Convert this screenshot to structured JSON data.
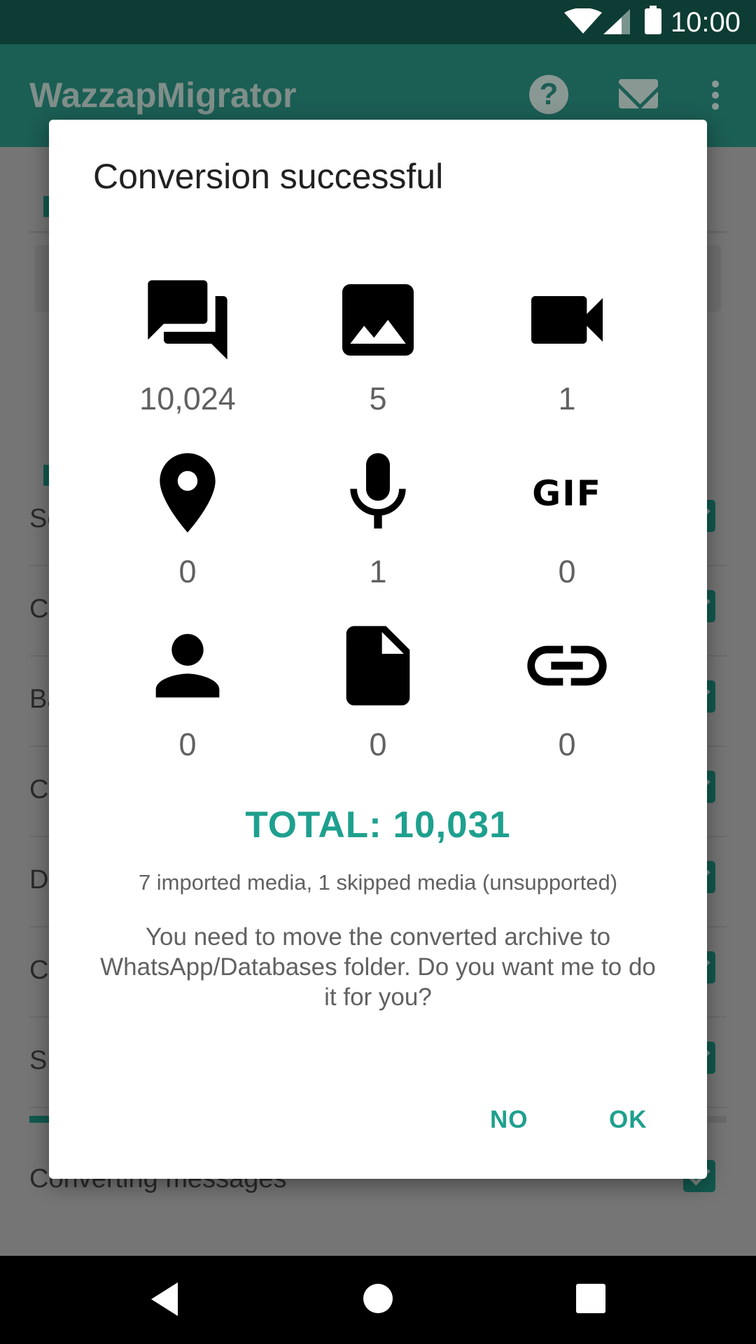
{
  "status_bar": {
    "time": "10:00"
  },
  "app_bar": {
    "title": "WazzapMigrator"
  },
  "background": {
    "rows": [
      {
        "label": "Se"
      },
      {
        "label": "Cr"
      },
      {
        "label": "Ba"
      },
      {
        "label": "Co"
      },
      {
        "label": "De"
      },
      {
        "label": "Cr"
      },
      {
        "label": "Sp"
      },
      {
        "label": "Converting messages"
      }
    ]
  },
  "dialog": {
    "title": "Conversion successful",
    "stats": [
      {
        "icon": "chat-icon",
        "value": "10,024"
      },
      {
        "icon": "image-icon",
        "value": "5"
      },
      {
        "icon": "video-icon",
        "value": "1"
      },
      {
        "icon": "location-icon",
        "value": "0"
      },
      {
        "icon": "microphone-icon",
        "value": "1"
      },
      {
        "icon": "gif-icon",
        "value": "0",
        "icon_text": "GIF"
      },
      {
        "icon": "contact-icon",
        "value": "0"
      },
      {
        "icon": "document-icon",
        "value": "0"
      },
      {
        "icon": "link-icon",
        "value": "0"
      }
    ],
    "total": "TOTAL: 10,031",
    "media_info": "7 imported media, 1 skipped media (unsupported)",
    "message": "You need to move the converted archive to WhatsApp/Databases folder. Do you want me to do it for you?",
    "buttons": {
      "no": "NO",
      "ok": "OK"
    }
  },
  "colors": {
    "accent": "#1ea08e",
    "status_bar": "#0c3c33",
    "app_bar": "#1b5e54"
  }
}
